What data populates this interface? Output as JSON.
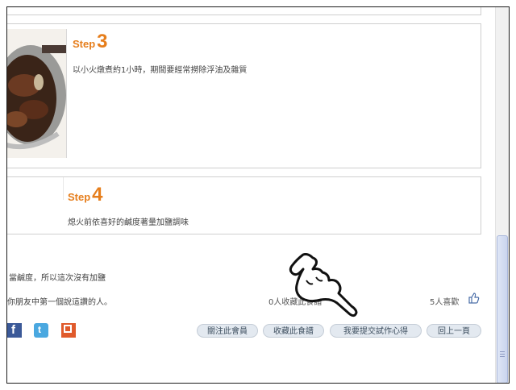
{
  "steps": [
    {
      "word": "Step",
      "number": "3",
      "text": "以小火燉煮約1小時，期間要經常撈除浮油及雜質"
    },
    {
      "word": "Step",
      "number": "4",
      "text": "熄火前依喜好的鹹度著量加鹽調味"
    }
  ],
  "tips": {
    "text": "當鹹度，所以這次沒有加鹽"
  },
  "social": {
    "friend_text": "你朋友中第一個說這讚的人。",
    "collect_count_text": "0人收藏此食譜",
    "likes_text": "5人喜歡"
  },
  "share_icons": [
    "facebook-icon",
    "twitter-icon",
    "plurk-icon"
  ],
  "actions": {
    "follow": "關注此會員",
    "collect": "收藏此食譜",
    "submit": "我要提交試作心得",
    "back": "回上一頁"
  },
  "colors": {
    "step_accent": "#e67e1c",
    "button_bg": "#e3e9f0",
    "button_text": "#3f5060"
  }
}
